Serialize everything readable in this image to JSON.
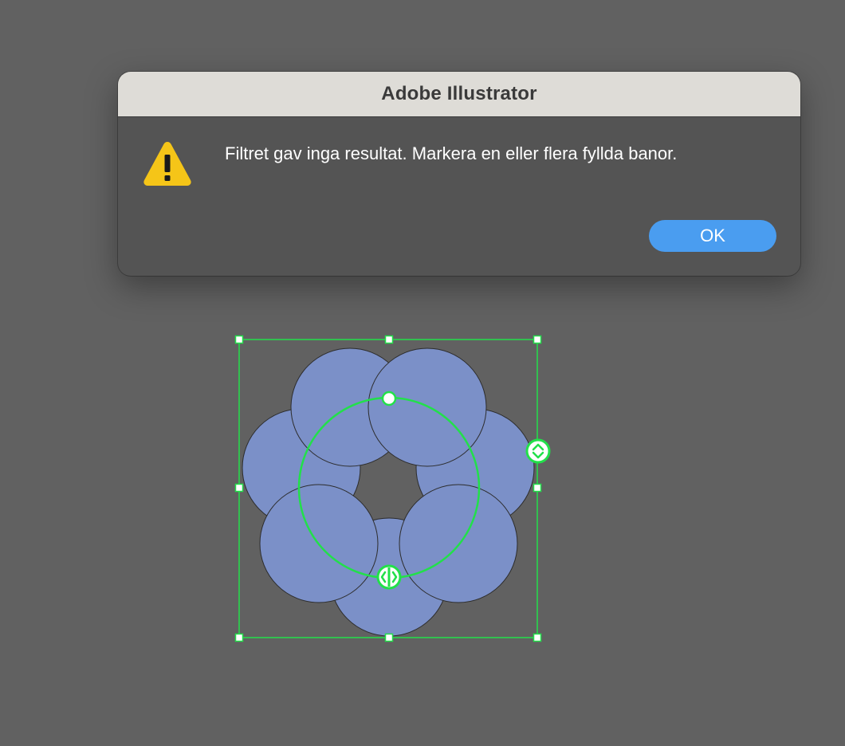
{
  "dialog": {
    "title": "Adobe Illustrator",
    "message": "Filtret gav inga resultat. Markera en eller flera fyllda banor.",
    "icon": "warning-icon",
    "ok_label": "OK"
  },
  "artwork": {
    "shape_count": 7,
    "fill_color": "#7b90c8",
    "stroke_color": "#2c2c2c",
    "selection_color": "#22e04a",
    "canvas_color": "#616161"
  },
  "colors": {
    "accent": "#4a9df0",
    "warning": "#f5c518",
    "titlebar": "#dedcd7",
    "dialog_body": "#545454"
  }
}
